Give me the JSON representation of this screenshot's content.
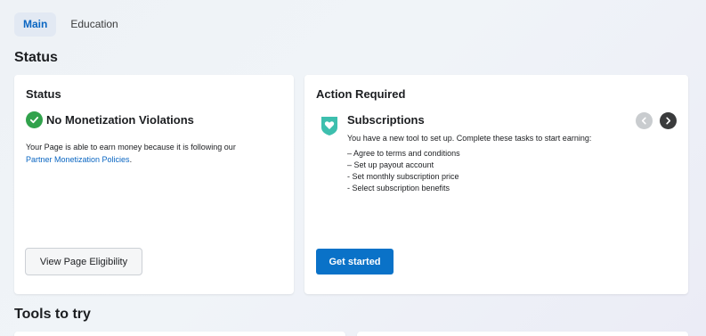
{
  "tabs": [
    {
      "label": "Main",
      "active": true
    },
    {
      "label": "Education",
      "active": false
    }
  ],
  "status_section_title": "Status",
  "status_card": {
    "title": "Status",
    "check_label": "No Monetization Violations",
    "description": "Your Page is able to earn money because it is following our",
    "policy_link": "Partner Monetization Policies",
    "policy_suffix": ".",
    "button_label": "View Page Eligibility"
  },
  "action_card": {
    "title": "Action Required",
    "item_title": "Subscriptions",
    "item_description": "You have a new tool to set up. Complete these tasks to start earning:",
    "tasks": [
      "– Agree to terms and conditions",
      "– Set up payout account",
      "- Set monthly subscription price",
      "- Select subscription benefits"
    ],
    "button_label": "Get started"
  },
  "tools_section_title": "Tools to try",
  "colors": {
    "accent_blue": "#0a72c8",
    "success_green": "#31a24c",
    "subscription_teal": "#3dbfae"
  },
  "icons": {
    "status_check": "check-circle-icon",
    "subscriptions": "heart-shield-icon",
    "prev": "chevron-left-icon",
    "next": "chevron-right-icon"
  }
}
